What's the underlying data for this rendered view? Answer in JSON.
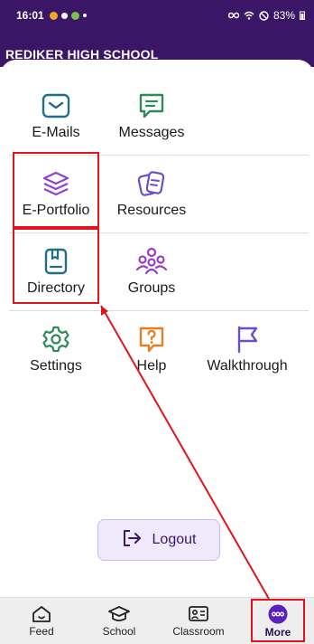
{
  "status_bar": {
    "time": "16:01",
    "battery": "83%"
  },
  "header": {
    "school_name": "REDIKER HIGH SCHOOL"
  },
  "menu": {
    "emails": "E-Mails",
    "messages": "Messages",
    "eportfolio": "E-Portfolio",
    "resources": "Resources",
    "directory": "Directory",
    "groups": "Groups",
    "settings": "Settings",
    "help": "Help",
    "walkthrough": "Walkthrough"
  },
  "logout_label": "Logout",
  "bottom_nav": {
    "feed": "Feed",
    "school": "School",
    "classroom": "Classroom",
    "more": "More"
  },
  "icons": {
    "emails": "mail-icon",
    "messages": "chat-icon",
    "eportfolio": "layers-icon",
    "resources": "docs-icon",
    "directory": "book-icon",
    "groups": "group-icon",
    "settings": "gear-icon",
    "help": "help-icon",
    "walkthrough": "flag-icon"
  },
  "colors": {
    "header_bg": "#3b1667",
    "teal": "#1f6f8b",
    "green": "#2e8b57",
    "purple": "#8e44c9",
    "orange": "#e67e22",
    "annotation_red": "#e0141a"
  }
}
